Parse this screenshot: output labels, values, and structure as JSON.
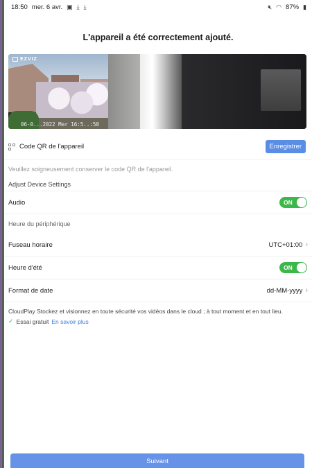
{
  "status_bar": {
    "time": "18:50",
    "date": "mer. 6 avr.",
    "battery": "87%",
    "left_icons": [
      "gallery-icon",
      "download-icon",
      "download-icon"
    ],
    "right_icons": [
      "mute-icon",
      "wifi-icon",
      "battery-icon"
    ]
  },
  "header": {
    "title": "L'appareil a été correctement ajouté."
  },
  "preview": {
    "brand": "EZVIZ",
    "osd_text": "06-0...2022 Mer 16:5..:50"
  },
  "qr": {
    "label": "Code QR de l'appareil",
    "button": "Enregistrer",
    "note": "Veuillez soigneusement conserver le code QR de l'appareil."
  },
  "settings": {
    "section_title": "Adjust Device Settings",
    "audio_label": "Audio",
    "audio_state": "ON",
    "time_section": "Heure du périphérique",
    "timezone_label": "Fuseau horaire",
    "timezone_value": "UTC+01:00",
    "dst_label": "Heure d'été",
    "dst_state": "ON",
    "date_format_label": "Format de date",
    "date_format_value": "dd-MM-yyyy"
  },
  "cloud": {
    "text": "CloudPlay Stockez et visionnez en toute sécurité vos vidéos dans le cloud ; à tout moment et en tout lieu.",
    "trial_label": "Essai gratuit",
    "learn_more": "En savoir plus"
  },
  "footer": {
    "next_button": "Suivant"
  },
  "colors": {
    "accent": "#5a8ee6",
    "toggle_on": "#3cb84a",
    "link": "#3a7de0"
  }
}
